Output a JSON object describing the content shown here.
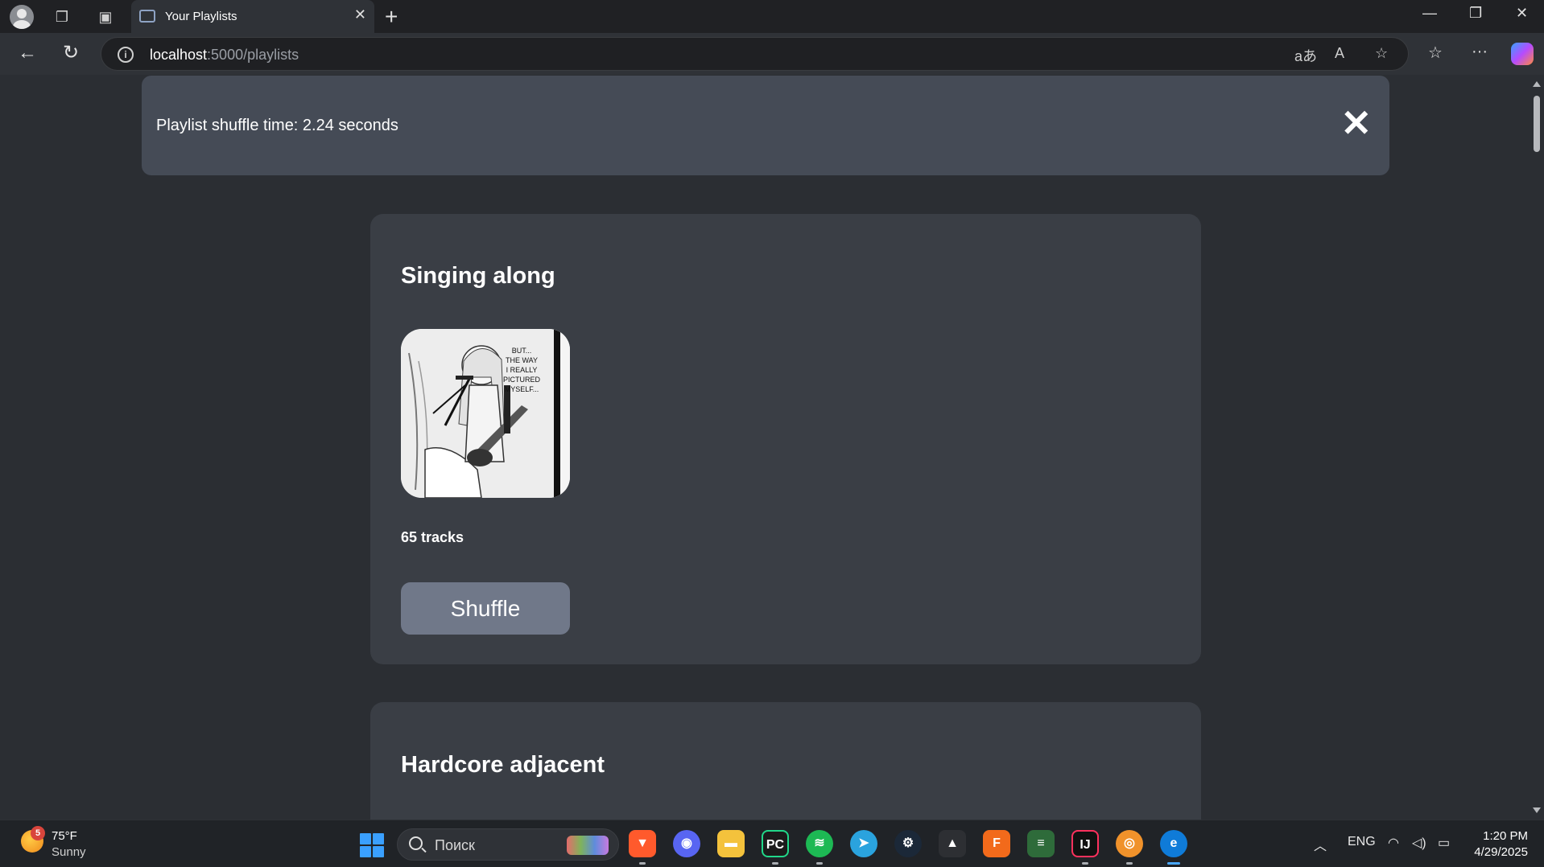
{
  "browser": {
    "tab_title": "Your Playlists",
    "tab_close_icon": "close-icon",
    "url_host": "localhost",
    "url_path": ":5000/playlists",
    "window_controls": [
      "minimize-icon",
      "restore-icon",
      "close-icon"
    ]
  },
  "notification": {
    "message": "Playlist shuffle time: 2.24 seconds",
    "close_icon": "close-icon"
  },
  "playlists": [
    {
      "name": "Singing along",
      "track_count_label": "65 tracks",
      "shuffle_label": "Shuffle",
      "cover_text": "BUT... THE WAY I REALLY PICTURED MYSELF..."
    },
    {
      "name": "Hardcore adjacent"
    }
  ],
  "taskbar": {
    "weather_temp": "75°F",
    "weather_condition": "Sunny",
    "weather_badge": "5",
    "search_placeholder": "Поиск",
    "language": "ENG",
    "time": "1:20 PM",
    "date": "4/29/2025"
  },
  "colors": {
    "page_bg": "#2b2e33",
    "card_bg": "#3a3e45",
    "toast_bg": "#454b56",
    "button_bg": "#707889"
  }
}
